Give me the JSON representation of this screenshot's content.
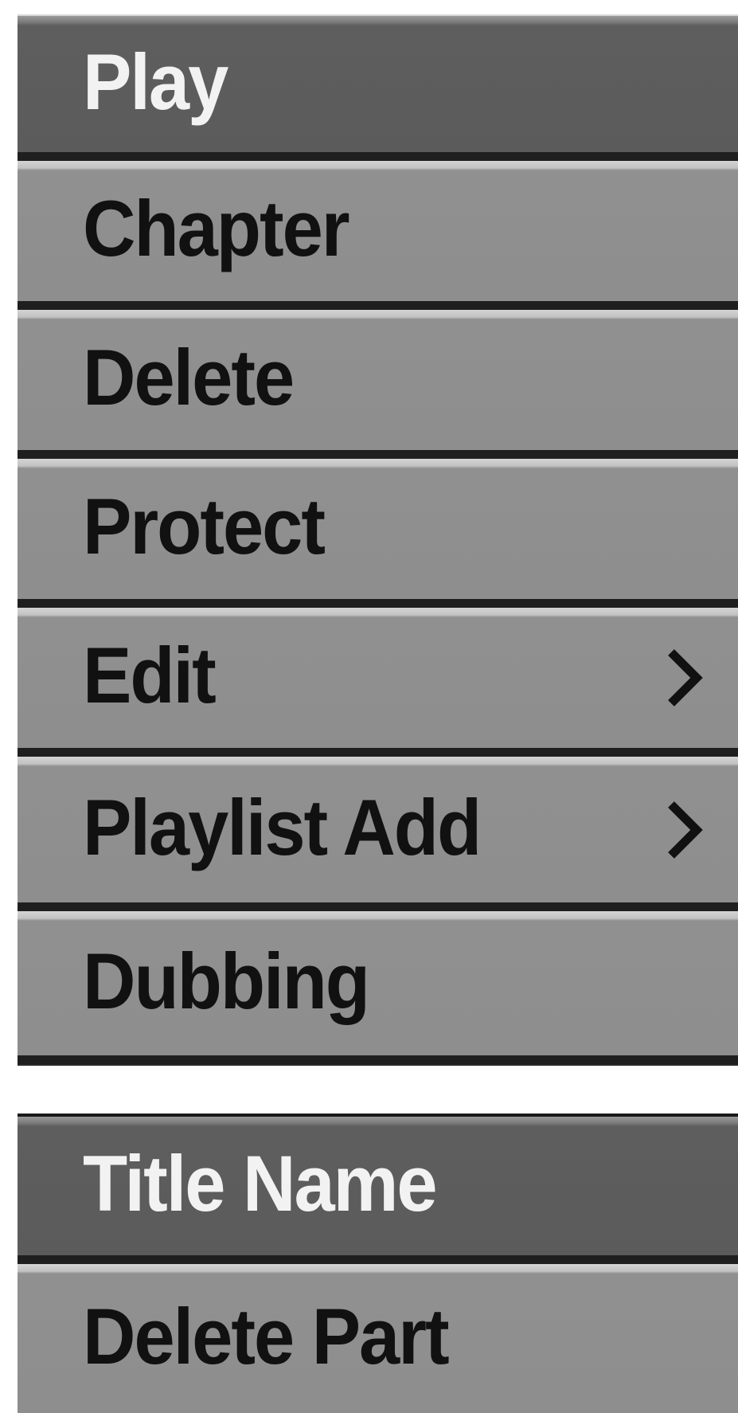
{
  "menu_main": {
    "items": [
      {
        "label": "Play",
        "selected": true,
        "submenu": false
      },
      {
        "label": "Chapter",
        "selected": false,
        "submenu": false
      },
      {
        "label": "Delete",
        "selected": false,
        "submenu": false
      },
      {
        "label": "Protect",
        "selected": false,
        "submenu": false
      },
      {
        "label": "Edit",
        "selected": false,
        "submenu": true
      },
      {
        "label": "Playlist Add",
        "selected": false,
        "submenu": true
      },
      {
        "label": "Dubbing",
        "selected": false,
        "submenu": false
      }
    ]
  },
  "menu_edit": {
    "items": [
      {
        "label": "Title Name",
        "selected": true,
        "submenu": false
      },
      {
        "label": "Delete Part",
        "selected": false,
        "submenu": false
      }
    ]
  },
  "colors": {
    "item_bg": "#8e8e8e",
    "selected_bg": "#5b5b5b",
    "separator": "#1f1f1f",
    "text": "#111111",
    "selected_text": "#f2f2f2"
  }
}
